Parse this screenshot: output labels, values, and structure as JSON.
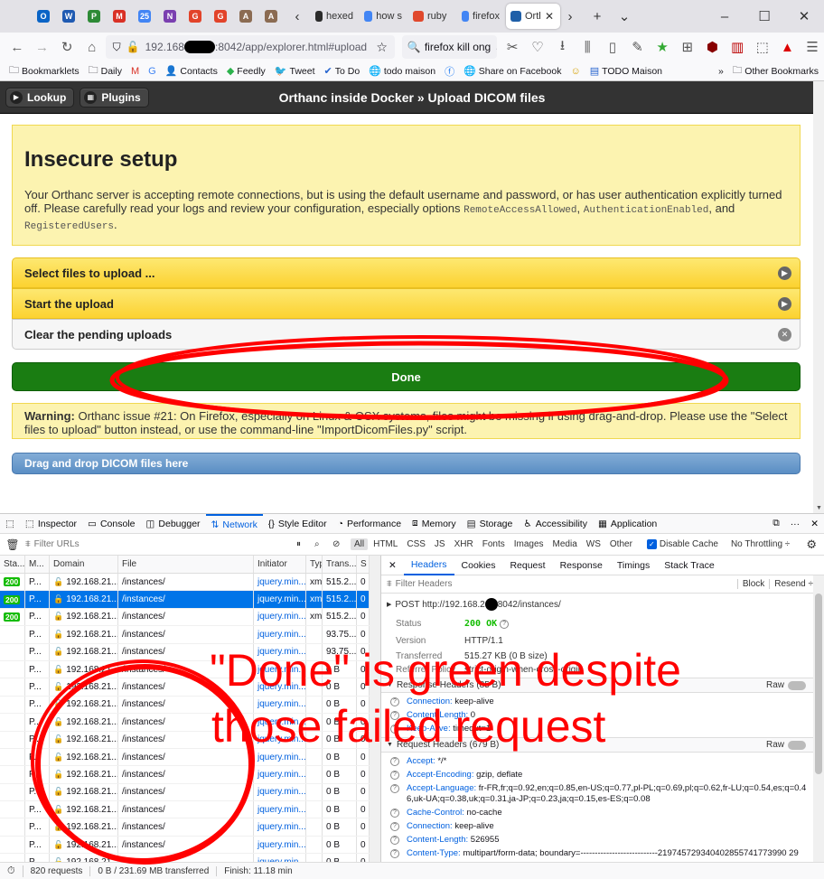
{
  "browser": {
    "tabs": [
      {
        "label": "hexed",
        "icon": "hexed-favicon-icon",
        "color": "#2b2b2b"
      },
      {
        "label": "how s",
        "icon": "google-favicon-icon",
        "color": "#4285f4"
      },
      {
        "label": "ruby",
        "icon": "ruby-favicon-icon",
        "color": "#e0482c"
      },
      {
        "label": "firefox",
        "icon": "google-favicon-icon",
        "color": "#4285f4"
      },
      {
        "label": "Ortl",
        "icon": "orthanc-favicon-icon",
        "color": "#1f5fa8"
      }
    ],
    "pinned": [
      {
        "icon": "outlook-icon",
        "color": "#0a64c6",
        "glyph": "O"
      },
      {
        "icon": "word-icon",
        "color": "#1f5ab2",
        "glyph": "W"
      },
      {
        "icon": "project-icon",
        "color": "#2d8a36",
        "glyph": "P"
      },
      {
        "icon": "gmail-icon",
        "color": "#d93025",
        "glyph": "M"
      },
      {
        "icon": "calendar-icon",
        "color": "#4285f4",
        "glyph": "25"
      },
      {
        "icon": "onenote-icon",
        "color": "#7a3fb0",
        "glyph": "N"
      },
      {
        "icon": "gitlab-icon",
        "color": "#e2432a",
        "glyph": "G"
      },
      {
        "icon": "gitlab-icon",
        "color": "#e2432a",
        "glyph": "G"
      },
      {
        "icon": "avatar-icon",
        "color": "#8b6b52",
        "glyph": "A"
      },
      {
        "icon": "avatar-icon",
        "color": "#8b6b52",
        "glyph": "A"
      }
    ],
    "url_prefix": "192.168",
    "url_suffix": ":8042/app/explorer.html#upload",
    "search_text": "firefox kill ong",
    "bookmarks": [
      {
        "label": "Bookmarklets",
        "icon": "folder-icon"
      },
      {
        "label": "Daily",
        "icon": "folder-icon"
      },
      {
        "label": "",
        "icon": "gmail-icon"
      },
      {
        "label": "",
        "icon": "google-icon"
      },
      {
        "label": "Contacts",
        "icon": "contacts-icon"
      },
      {
        "label": "Feedly",
        "icon": "feedly-icon"
      },
      {
        "label": "Tweet",
        "icon": "twitter-icon"
      },
      {
        "label": "To Do",
        "icon": "todo-icon"
      },
      {
        "label": "todo maison",
        "icon": "globe-icon"
      },
      {
        "label": "",
        "icon": "facebook-icon"
      },
      {
        "label": "Share on Facebook",
        "icon": "globe-icon"
      },
      {
        "label": "",
        "icon": "smiley-icon"
      },
      {
        "label": "TODO Maison",
        "icon": "document-icon"
      }
    ],
    "other_bookmarks": "Other Bookmarks"
  },
  "orthanc": {
    "lookup": "Lookup",
    "plugins": "Plugins",
    "title": "Orthanc inside Docker » Upload DICOM files",
    "insecure_title": "Insecure setup",
    "insecure_text_1": "Your Orthanc server is accepting remote connections, but is using the default username and password, or has user authentication explicitly turned off. Please carefully read your logs and review your configuration, especially options ",
    "opt1": "RemoteAccessAllowed",
    "sep1": ", ",
    "opt2": "AuthenticationEnabled",
    "sep2": ", and ",
    "opt3": "RegisteredUsers",
    "end": ".",
    "select_files": "Select files to upload ...",
    "start_upload": "Start the upload",
    "clear_pending": "Clear the pending uploads",
    "done": "Done",
    "warning_label": "Warning:",
    "warning_text": " Orthanc issue #21: On Firefox, especially on Linux & OSX systems, files might be missing if using drag-and-drop. Please use the \"Select files to upload\" button instead, or use the command-line \"ImportDicomFiles.py\" script.",
    "drag_drop": "Drag and drop DICOM files here"
  },
  "devtools": {
    "tabs": [
      "Inspector",
      "Console",
      "Debugger",
      "Network",
      "Style Editor",
      "Performance",
      "Memory",
      "Storage",
      "Accessibility",
      "Application"
    ],
    "filter_placeholder": "Filter URLs",
    "types": [
      "All",
      "HTML",
      "CSS",
      "JS",
      "XHR",
      "Fonts",
      "Images",
      "Media",
      "WS",
      "Other"
    ],
    "disable_cache": "Disable Cache",
    "throttling": "No Throttling ÷",
    "cols": [
      "Sta...",
      "M...",
      "Domain",
      "File",
      "Initiator",
      "Typ",
      "Trans...",
      "S"
    ],
    "rows": [
      {
        "status": "200",
        "method": "P...",
        "domain": "192.168.21....",
        "file": "/instances/",
        "init": "jquery.min...",
        "type": "xml",
        "size": "515.2...",
        "s": "0"
      },
      {
        "status": "200",
        "method": "P...",
        "domain": "192.168.21....",
        "file": "/instances/",
        "init": "jquery.min...",
        "type": "xml",
        "size": "515.2...",
        "s": "0",
        "sel": true
      },
      {
        "status": "200",
        "method": "P...",
        "domain": "192.168.21....",
        "file": "/instances/",
        "init": "jquery.min...",
        "type": "xml",
        "size": "515.2...",
        "s": "0"
      },
      {
        "status": "",
        "method": "P...",
        "domain": "192.168.21....",
        "file": "/instances/",
        "init": "jquery.min...",
        "type": "",
        "size": "93.75...",
        "s": "0"
      },
      {
        "status": "",
        "method": "P...",
        "domain": "192.168.21....",
        "file": "/instances/",
        "init": "jquery.min...",
        "type": "",
        "size": "93.75...",
        "s": "0"
      },
      {
        "status": "",
        "method": "P...",
        "domain": "192.168.21....",
        "file": "/instances/",
        "init": "jquery.min...",
        "type": "",
        "size": "0 B",
        "s": "0"
      },
      {
        "status": "",
        "method": "P...",
        "domain": "192.168.21....",
        "file": "/instances/",
        "init": "jquery.min...",
        "type": "",
        "size": "0 B",
        "s": "0"
      },
      {
        "status": "",
        "method": "P...",
        "domain": "192.168.21....",
        "file": "/instances/",
        "init": "jquery.min...",
        "type": "",
        "size": "0 B",
        "s": "0"
      },
      {
        "status": "",
        "method": "P...",
        "domain": "192.168.21....",
        "file": "/instances/",
        "init": "jquery.min...",
        "type": "",
        "size": "0 B",
        "s": "0"
      },
      {
        "status": "",
        "method": "P...",
        "domain": "192.168.21....",
        "file": "/instances/",
        "init": "jquery.min...",
        "type": "",
        "size": "0 B",
        "s": "0"
      },
      {
        "status": "",
        "method": "P...",
        "domain": "192.168.21....",
        "file": "/instances/",
        "init": "jquery.min...",
        "type": "",
        "size": "0 B",
        "s": "0"
      },
      {
        "status": "",
        "method": "P...",
        "domain": "192.168.21....",
        "file": "/instances/",
        "init": "jquery.min...",
        "type": "",
        "size": "0 B",
        "s": "0"
      },
      {
        "status": "",
        "method": "P...",
        "domain": "192.168.21....",
        "file": "/instances/",
        "init": "jquery.min...",
        "type": "",
        "size": "0 B",
        "s": "0"
      },
      {
        "status": "",
        "method": "P...",
        "domain": "192.168.21....",
        "file": "/instances/",
        "init": "jquery.min...",
        "type": "",
        "size": "0 B",
        "s": "0"
      },
      {
        "status": "",
        "method": "P...",
        "domain": "192.168.21....",
        "file": "/instances/",
        "init": "jquery.min...",
        "type": "",
        "size": "0 B",
        "s": "0"
      },
      {
        "status": "",
        "method": "P...",
        "domain": "192.168.21....",
        "file": "/instances/",
        "init": "jquery.min...",
        "type": "",
        "size": "0 B",
        "s": "0"
      },
      {
        "status": "",
        "method": "P...",
        "domain": "192.168.21....",
        "file": "/instances/",
        "init": "jquery.min...",
        "type": "",
        "size": "0 B",
        "s": "0"
      }
    ],
    "detail_tabs": [
      "Headers",
      "Cookies",
      "Request",
      "Response",
      "Timings",
      "Stack Trace"
    ],
    "filter_headers": "Filter Headers",
    "block": "Block",
    "resend": "Resend ÷",
    "post_line_prefix": "POST  http://192.168.2",
    "post_line_suffix": "8042/instances/",
    "status_label": "Status",
    "status_value": "200 OK",
    "version_label": "Version",
    "version_value": "HTTP/1.1",
    "transferred_label": "Transferred",
    "transferred_value": "515.27 KB (0 B size)",
    "referrer_label": "Referrer Policy",
    "referrer_value": "strict-origin-when-cross-origin",
    "resp_headers": "Response Headers (85 B)",
    "raw": "Raw",
    "resp_list": [
      {
        "k": "Connection:",
        "v": "keep-alive"
      },
      {
        "k": "Content-Length:",
        "v": "0"
      },
      {
        "k": "Keep-Alive:",
        "v": "timeout=1"
      }
    ],
    "req_headers": "Request Headers (679 B)",
    "req_list": [
      {
        "k": "Accept:",
        "v": "*/*"
      },
      {
        "k": "Accept-Encoding:",
        "v": "gzip, deflate"
      },
      {
        "k": "Accept-Language:",
        "v": "fr-FR,fr;q=0.92,en;q=0.85,en-US;q=0.77,pl-PL;q=0.69,pl;q=0.62,fr-LU;q=0.54,es;q=0.46,uk-UA;q=0.38,uk;q=0.31,ja-JP;q=0.23,ja;q=0.15,es-ES;q=0.08"
      },
      {
        "k": "Cache-Control:",
        "v": "no-cache"
      },
      {
        "k": "Connection:",
        "v": "keep-alive"
      },
      {
        "k": "Content-Length:",
        "v": "526955"
      },
      {
        "k": "Content-Type:",
        "v": "multipart/form-data; boundary=---------------------------219745729340402855741773990 29"
      }
    ],
    "status_requests": "820 requests",
    "status_transferred": "0 B / 231.69 MB transferred",
    "status_finish": "Finish: 11.18 min"
  },
  "annotation": {
    "line1": "\"Done\" is green despite",
    "line2": "those failed request",
    "color": "#ff0000"
  }
}
